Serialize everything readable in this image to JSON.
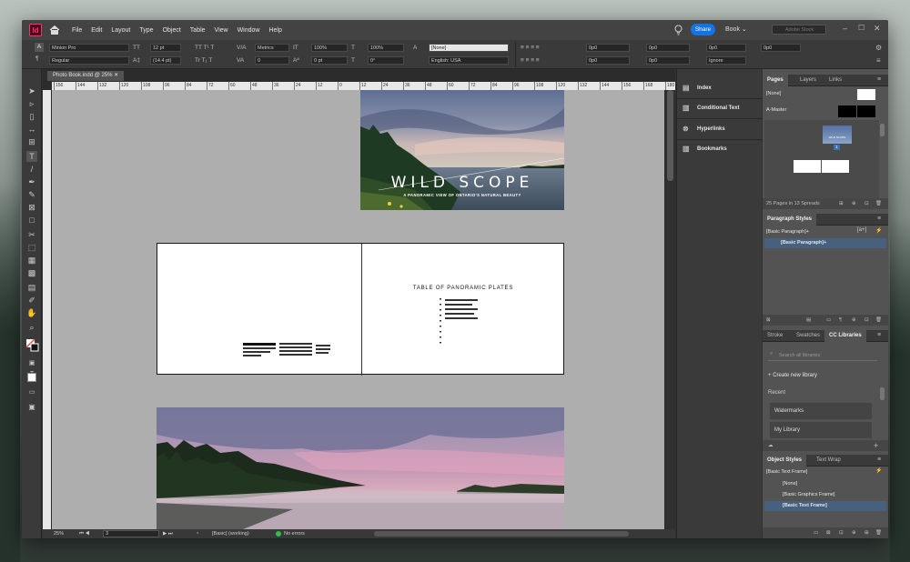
{
  "app": {
    "logo": "Id"
  },
  "menu": [
    "File",
    "Edit",
    "Layout",
    "Type",
    "Object",
    "Table",
    "View",
    "Window",
    "Help"
  ],
  "topbar": {
    "share": "Share",
    "workspace": "Book",
    "search_placeholder": "Adobe Stock"
  },
  "control": {
    "font": "Minion Pro",
    "style": "Regular",
    "size": "12 pt",
    "leading": "(14.4 pt)",
    "kerning": "Metrics",
    "tracking": "0",
    "vscale": "100%",
    "hscale": "100%",
    "baseline": "0 pt",
    "skew": "0°",
    "charstyle": "[None]",
    "language": "English: USA",
    "indent1": "0p0",
    "indent2": "0p0",
    "indent3": "0p0",
    "indent4": "0p0",
    "space1": "0p0",
    "space2": "0p0",
    "hyphen": "Ignore",
    "cols": "0p0"
  },
  "document": {
    "tab": "Photo Book.indd @ 25%",
    "ruler": [
      "156",
      "144",
      "132",
      "120",
      "108",
      "96",
      "84",
      "72",
      "60",
      "48",
      "36",
      "24",
      "12",
      "0",
      "12",
      "24",
      "36",
      "48",
      "60",
      "72",
      "84",
      "96",
      "108",
      "120",
      "132",
      "144",
      "156",
      "168",
      "180"
    ],
    "cover_title": "WILD SCOPE",
    "cover_subtitle": "A PANORAMIC VIEW OF ONTARIO'S NATURAL BEAUTY",
    "toc_title": "TABLE OF PANORAMIC PLATES"
  },
  "status": {
    "zoom": "25%",
    "page": "3",
    "style": "[Basic] (working)",
    "errors": "No errors"
  },
  "dock": {
    "items": [
      "Index",
      "Conditional Text",
      "Hyperlinks",
      "Bookmarks"
    ]
  },
  "pages_panel": {
    "tabs": [
      "Pages",
      "Layers",
      "Links"
    ],
    "none_label": "[None]",
    "master_label": "A-Master",
    "thumb_label": "WILD SCOPE",
    "page_num": "1",
    "footer": "25 Pages in 13 Spreads"
  },
  "para_panel": {
    "title": "Paragraph Styles",
    "current": "[Basic Paragraph]+",
    "item": "[Basic Paragraph]+"
  },
  "lib_panel": {
    "tabs": [
      "Stroke",
      "Swatches",
      "CC Libraries"
    ],
    "search_placeholder": "Search all libraries",
    "create": "Create new library",
    "recent": "Recent",
    "libraries": [
      "Watermarks",
      "My Library"
    ]
  },
  "obj_panel": {
    "tabs": [
      "Object Styles",
      "Text Wrap"
    ],
    "current": "[Basic Text Frame]",
    "items": [
      "[None]",
      "[Basic Graphics Frame]",
      "[Basic Text Frame]"
    ]
  },
  "colors": {
    "accent": "#1473e6",
    "selection": "#46607e",
    "brand": "#ff3366",
    "ok": "#2fbf4a"
  }
}
